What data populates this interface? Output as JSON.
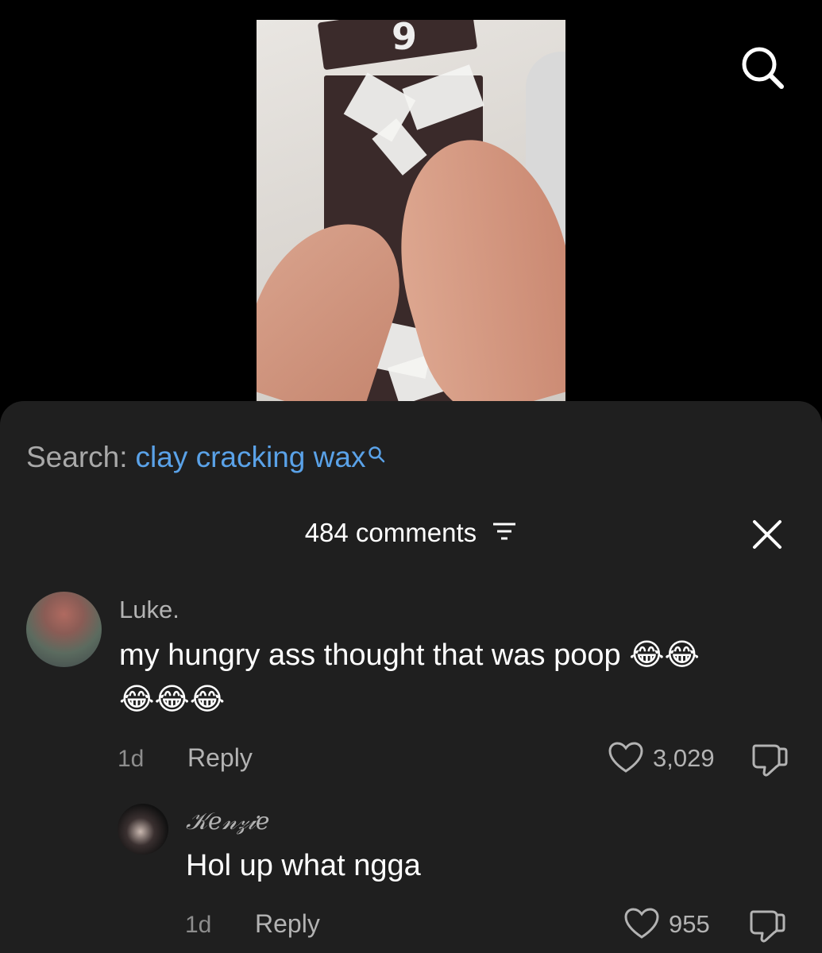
{
  "video": {
    "overlay_number": "9"
  },
  "search": {
    "prefix": "Search:",
    "query": "clay cracking wax"
  },
  "comments_header": {
    "count_label": "484 comments"
  },
  "comments": [
    {
      "username": "Luke.",
      "text": "my hungry ass thought that was poop 😂😂",
      "text_line2": "😂😂😂",
      "age": "1d",
      "reply_label": "Reply",
      "likes": "3,029"
    },
    {
      "username": "𝒦𝑒𝓃𝓏𝒾𝑒",
      "text": "Hol up what ngga",
      "age": "1d",
      "reply_label": "Reply",
      "likes": "955"
    }
  ],
  "colors": {
    "background": "#000000",
    "sheet": "#1f1f1f",
    "link_blue": "#5aa2e8",
    "muted_text": "#b3b3b3"
  },
  "icons": [
    "search-icon",
    "filter-icon",
    "close-icon",
    "heart-icon",
    "dislike-icon"
  ]
}
